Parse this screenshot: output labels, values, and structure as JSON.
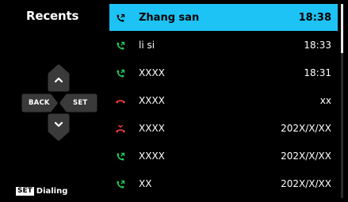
{
  "header": {
    "title": "Recents"
  },
  "controls": {
    "back_label": "BACK",
    "set_label": "SET",
    "up_icon": "chevron-up-icon",
    "down_icon": "chevron-down-icon"
  },
  "hint": {
    "key": "SET",
    "text": "Dialing"
  },
  "calls": [
    {
      "name": "Zhang san",
      "time": "18:38",
      "type": "outgoing",
      "icon": "phone-outgoing-icon",
      "color": "#000000",
      "selected": true
    },
    {
      "name": "li si",
      "time": "18:33",
      "type": "outgoing",
      "icon": "phone-outgoing-icon",
      "color": "#1fd45a",
      "selected": false
    },
    {
      "name": "XXXX",
      "time": "18:31",
      "type": "outgoing",
      "icon": "phone-outgoing-icon",
      "color": "#1fd45a",
      "selected": false
    },
    {
      "name": "XXXX",
      "time": "xx",
      "type": "rejected",
      "icon": "phone-hangup-icon",
      "color": "#f23a3a",
      "selected": false
    },
    {
      "name": "XXXX",
      "time": "202X/X/XX",
      "type": "missed",
      "icon": "phone-missed-icon",
      "color": "#f23a3a",
      "selected": false
    },
    {
      "name": "XXXX",
      "time": "202X/X/XX",
      "type": "outgoing",
      "icon": "phone-outgoing-icon",
      "color": "#1fd45a",
      "selected": false
    },
    {
      "name": "XX",
      "time": "202X/X/XX",
      "type": "outgoing",
      "icon": "phone-outgoing-icon",
      "color": "#1fd45a",
      "selected": false
    }
  ],
  "colors": {
    "accent": "#1ec3f5",
    "pad": "#3a3a3a",
    "green": "#1fd45a",
    "red": "#f23a3a"
  }
}
